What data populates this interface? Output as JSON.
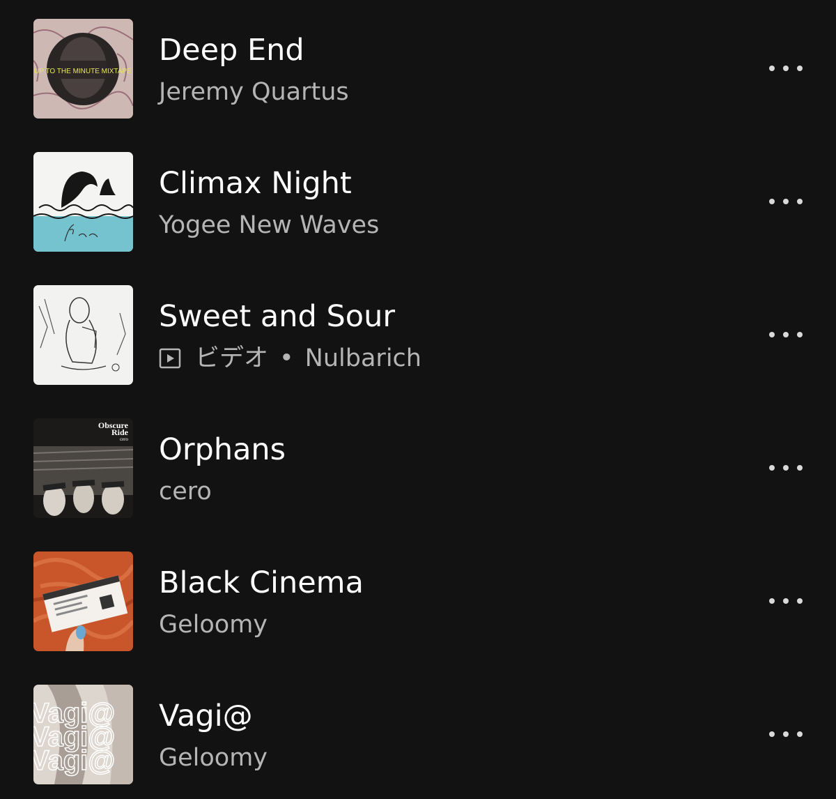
{
  "tracks": [
    {
      "title": "Deep End",
      "artist": "Jeremy Quartus",
      "artwork": "up-to-the-minute-mixtape-cover",
      "artwork_text": "UP TO THE MINUTE MIXTAPE",
      "more_icon": "more-horizontal-icon"
    },
    {
      "title": "Climax Night",
      "artist": "Yogee New Waves",
      "artwork": "paradise-wave-cover",
      "more_icon": "more-horizontal-icon"
    },
    {
      "title": "Sweet and Sour",
      "kind": "ビデオ",
      "separator": "•",
      "artist": "Nulbarich",
      "kind_icon": "video-play-icon",
      "artwork": "sketch-figure-cover",
      "more_icon": "more-horizontal-icon"
    },
    {
      "title": "Orphans",
      "artist": "cero",
      "artwork": "obscure-ride-cover",
      "artwork_text": [
        "Obscure",
        "Ride",
        "cero"
      ],
      "more_icon": "more-horizontal-icon"
    },
    {
      "title": "Black Cinema",
      "artist": "Geloomy",
      "artwork": "ticket-in-hand-cover",
      "more_icon": "more-horizontal-icon"
    },
    {
      "title": "Vagi@",
      "artist": "Geloomy",
      "artwork": "vagi-repeated-text-cover",
      "artwork_text": "Vagi@",
      "more_icon": "more-horizontal-icon"
    }
  ],
  "colors": {
    "background": "#121212",
    "title": "#ffffff",
    "subtitle": "#b5b5b5",
    "dots": "#d9d9d9"
  }
}
